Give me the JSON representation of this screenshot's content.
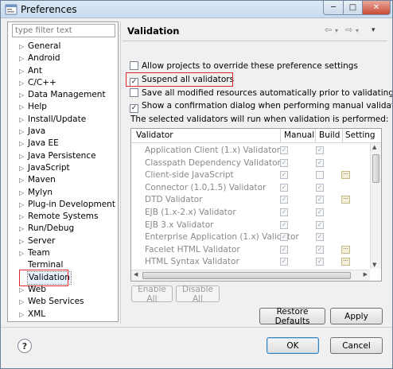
{
  "window": {
    "title": "Preferences",
    "minimize_glyph": "─",
    "maximize_glyph": "□",
    "close_glyph": "✕"
  },
  "left_panel": {
    "filter_placeholder": "type filter text",
    "selected": "Validation",
    "items": [
      {
        "label": "General",
        "expandable": true
      },
      {
        "label": "Android",
        "expandable": true
      },
      {
        "label": "Ant",
        "expandable": true
      },
      {
        "label": "C/C++",
        "expandable": true
      },
      {
        "label": "Data Management",
        "expandable": true
      },
      {
        "label": "Help",
        "expandable": true
      },
      {
        "label": "Install/Update",
        "expandable": true
      },
      {
        "label": "Java",
        "expandable": true
      },
      {
        "label": "Java EE",
        "expandable": true
      },
      {
        "label": "Java Persistence",
        "expandable": true
      },
      {
        "label": "JavaScript",
        "expandable": true
      },
      {
        "label": "Maven",
        "expandable": true
      },
      {
        "label": "Mylyn",
        "expandable": true
      },
      {
        "label": "Plug-in Development",
        "expandable": true
      },
      {
        "label": "Remote Systems",
        "expandable": true
      },
      {
        "label": "Run/Debug",
        "expandable": true
      },
      {
        "label": "Server",
        "expandable": true
      },
      {
        "label": "Team",
        "expandable": true
      },
      {
        "label": "Terminal",
        "expandable": false
      },
      {
        "label": "Validation",
        "expandable": false
      },
      {
        "label": "Web",
        "expandable": true
      },
      {
        "label": "Web Services",
        "expandable": true
      },
      {
        "label": "XML",
        "expandable": true
      }
    ]
  },
  "right_panel": {
    "title": "Validation",
    "nav_back": "⇦",
    "nav_back_menu": "▾",
    "nav_forward": "⇨",
    "nav_forward_menu": "▾",
    "view_menu": "▾",
    "options": [
      {
        "label": "Allow projects to override these preference settings",
        "checked": false
      },
      {
        "label": "Suspend all validators",
        "checked": true
      },
      {
        "label": "Save all modified resources automatically prior to validating",
        "checked": false
      },
      {
        "label": "Show a confirmation dialog when performing manual validations",
        "checked": true
      }
    ],
    "description": "The selected validators will run when validation is performed:",
    "table": {
      "columns": [
        "Validator",
        "Manual",
        "Build",
        "Setting"
      ],
      "rows": [
        {
          "name": "Application Client (1.x) Validator",
          "manual": true,
          "build": true,
          "settings": false
        },
        {
          "name": "Classpath Dependency Validator",
          "manual": true,
          "build": true,
          "settings": false
        },
        {
          "name": "Client-side JavaScript",
          "manual": true,
          "build": false,
          "settings": true
        },
        {
          "name": "Connector (1.0,1.5) Validator",
          "manual": true,
          "build": true,
          "settings": false
        },
        {
          "name": "DTD Validator",
          "manual": true,
          "build": true,
          "settings": true
        },
        {
          "name": "EJB (1.x-2.x) Validator",
          "manual": true,
          "build": true,
          "settings": false
        },
        {
          "name": "EJB 3.x Validator",
          "manual": true,
          "build": true,
          "settings": false
        },
        {
          "name": "Enterprise Application (1.x) Validator",
          "manual": true,
          "build": true,
          "settings": false
        },
        {
          "name": "Facelet HTML Validator",
          "manual": true,
          "build": true,
          "settings": true
        },
        {
          "name": "HTML Syntax Validator",
          "manual": true,
          "build": true,
          "settings": true
        }
      ]
    },
    "enable_all": "Enable All",
    "disable_all": "Disable All",
    "restore_defaults": "Restore Defaults",
    "apply": "Apply"
  },
  "footer": {
    "help_glyph": "?",
    "ok": "OK",
    "cancel": "Cancel"
  },
  "symbols": {
    "check": "✓",
    "settings_dots": "···",
    "tree_arrow": "▷",
    "scroll_up": "▲",
    "scroll_down": "▼",
    "scroll_left": "◀",
    "scroll_right": "▶"
  },
  "colors": {
    "highlight_box": "#e0282e",
    "selection_bg": "#e8f2fe"
  }
}
